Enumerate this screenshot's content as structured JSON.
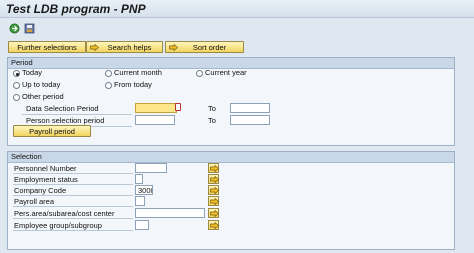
{
  "window": {
    "title": "Test LDB program - PNP"
  },
  "toolbar": {
    "buttons": [
      "Further selections",
      "Search helps",
      "Sort order"
    ]
  },
  "period": {
    "header": "Period",
    "radios": {
      "today": "Today",
      "current_month": "Current month",
      "current_year": "Current year",
      "up_to_today": "Up to today",
      "from_today": "From today",
      "other_period": "Other period"
    },
    "data_selection_label": "Data Selection Period",
    "person_selection_label": "Person selection period",
    "to_label_1": "To",
    "to_label_2": "To",
    "payroll_button": "Payroll period"
  },
  "selection": {
    "header": "Selection",
    "rows": [
      {
        "label": "Personnel Number",
        "value": ""
      },
      {
        "label": "Employment status",
        "value": ""
      },
      {
        "label": "Company Code",
        "value": "3000"
      },
      {
        "label": "Payroll area",
        "value": ""
      },
      {
        "label": "Pers.area/subarea/cost center",
        "value": ""
      },
      {
        "label": "Employee group/subgroup",
        "value": ""
      }
    ]
  }
}
